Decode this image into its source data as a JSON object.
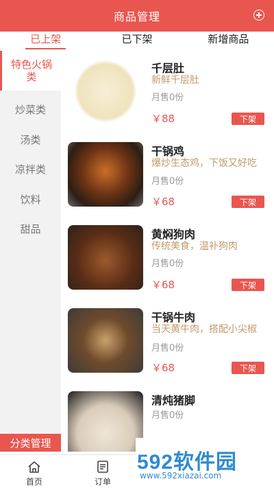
{
  "header": {
    "title": "商品管理"
  },
  "tabs": [
    {
      "label": "已上架",
      "active": true
    },
    {
      "label": "已下架",
      "active": false
    },
    {
      "label": "新增商品",
      "active": false
    }
  ],
  "sidebar": {
    "categories": [
      {
        "label": "特色火锅类",
        "active": true
      },
      {
        "label": "炒菜类",
        "active": false
      },
      {
        "label": "汤类",
        "active": false
      },
      {
        "label": "凉拌类",
        "active": false
      },
      {
        "label": "饮料",
        "active": false
      },
      {
        "label": "甜品",
        "active": false
      }
    ],
    "manage_label": "分类管理"
  },
  "items": [
    {
      "name": "千层肚",
      "desc": "新鲜千层肚",
      "sold": "月售0份",
      "price": "￥88",
      "action": "下架",
      "image": "tripe-plate"
    },
    {
      "name": "干锅鸡",
      "desc": "爆炒生态鸡，下饭又好吃",
      "sold": "月售0份",
      "price": "￥68",
      "action": "下架",
      "image": "dry-pot-chicken"
    },
    {
      "name": "黄焖狗肉",
      "desc": "传统美食，温补狗肉",
      "sold": "月售0份",
      "price": "￥68",
      "action": "下架",
      "image": "braised-dog-meat"
    },
    {
      "name": "干锅牛肉",
      "desc": "当天黄牛肉，搭配小尖椒",
      "sold": "月售0份",
      "price": "￥68",
      "action": "下架",
      "image": "dry-pot-beef"
    },
    {
      "name": "清炖猪脚",
      "desc": "",
      "sold": "月售0份",
      "price": "",
      "action": "",
      "image": "stewed-pork-feet"
    }
  ],
  "bottom_nav": [
    {
      "label": "首页",
      "icon": "home-icon"
    },
    {
      "label": "订单",
      "icon": "order-icon"
    }
  ],
  "watermark": {
    "brand": "592软件园",
    "url": "www.592xiazai.com"
  },
  "colors": {
    "accent": "#e9564f",
    "desc": "#c19a6b"
  }
}
